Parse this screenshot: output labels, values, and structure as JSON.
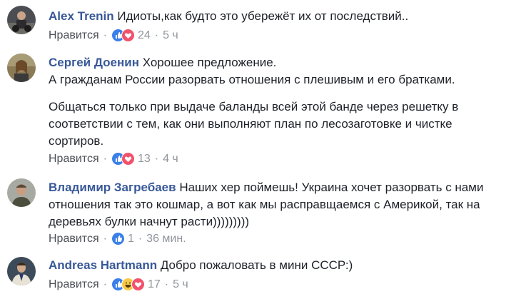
{
  "comments": [
    {
      "author": "Alex Trenin",
      "paragraphs": [
        "Идиоты,как будто это убережёт их от последствий.."
      ],
      "like_label": "Нравится",
      "reaction_icons": [
        "like-icon",
        "love-icon"
      ],
      "reaction_count": "24",
      "time": "5 ч"
    },
    {
      "author": "Сергей Доенин",
      "paragraphs": [
        "Хорошее предложение.",
        "А гражданам России разорвать отношения с плешивым и его братками.",
        "Общаться только при выдаче баланды всей этой банде через решетку в соответствии с тем, как они выполняют план по лесозаготовке и чистке сортиров."
      ],
      "like_label": "Нравится",
      "reaction_icons": [
        "like-icon",
        "love-icon"
      ],
      "reaction_count": "13",
      "time": "4 ч"
    },
    {
      "author": "Владимир Загребаев",
      "paragraphs": [
        "Наших хер поймешь! Украина хочет разорвать с нами отношения так это кошмар, а вот как мы расправщаемся с Америкой, так на деревьях булки начнут расти)))))))))"
      ],
      "like_label": "Нравится",
      "reaction_icons": [
        "like-icon"
      ],
      "reaction_count": "1",
      "time": "36 мин."
    },
    {
      "author": "Andreas Hartmann",
      "paragraphs": [
        "Добро пожаловать в мини СССР:)"
      ],
      "like_label": "Нравится",
      "reaction_icons": [
        "like-icon",
        "haha-icon",
        "love-icon"
      ],
      "reaction_count": "17",
      "time": "5 ч"
    }
  ],
  "separator": "·",
  "colors": {
    "author": "#385898",
    "meta": "#90949c",
    "like": "#3b7fe8",
    "love": "#f2526b",
    "haha": "#f7c948"
  }
}
